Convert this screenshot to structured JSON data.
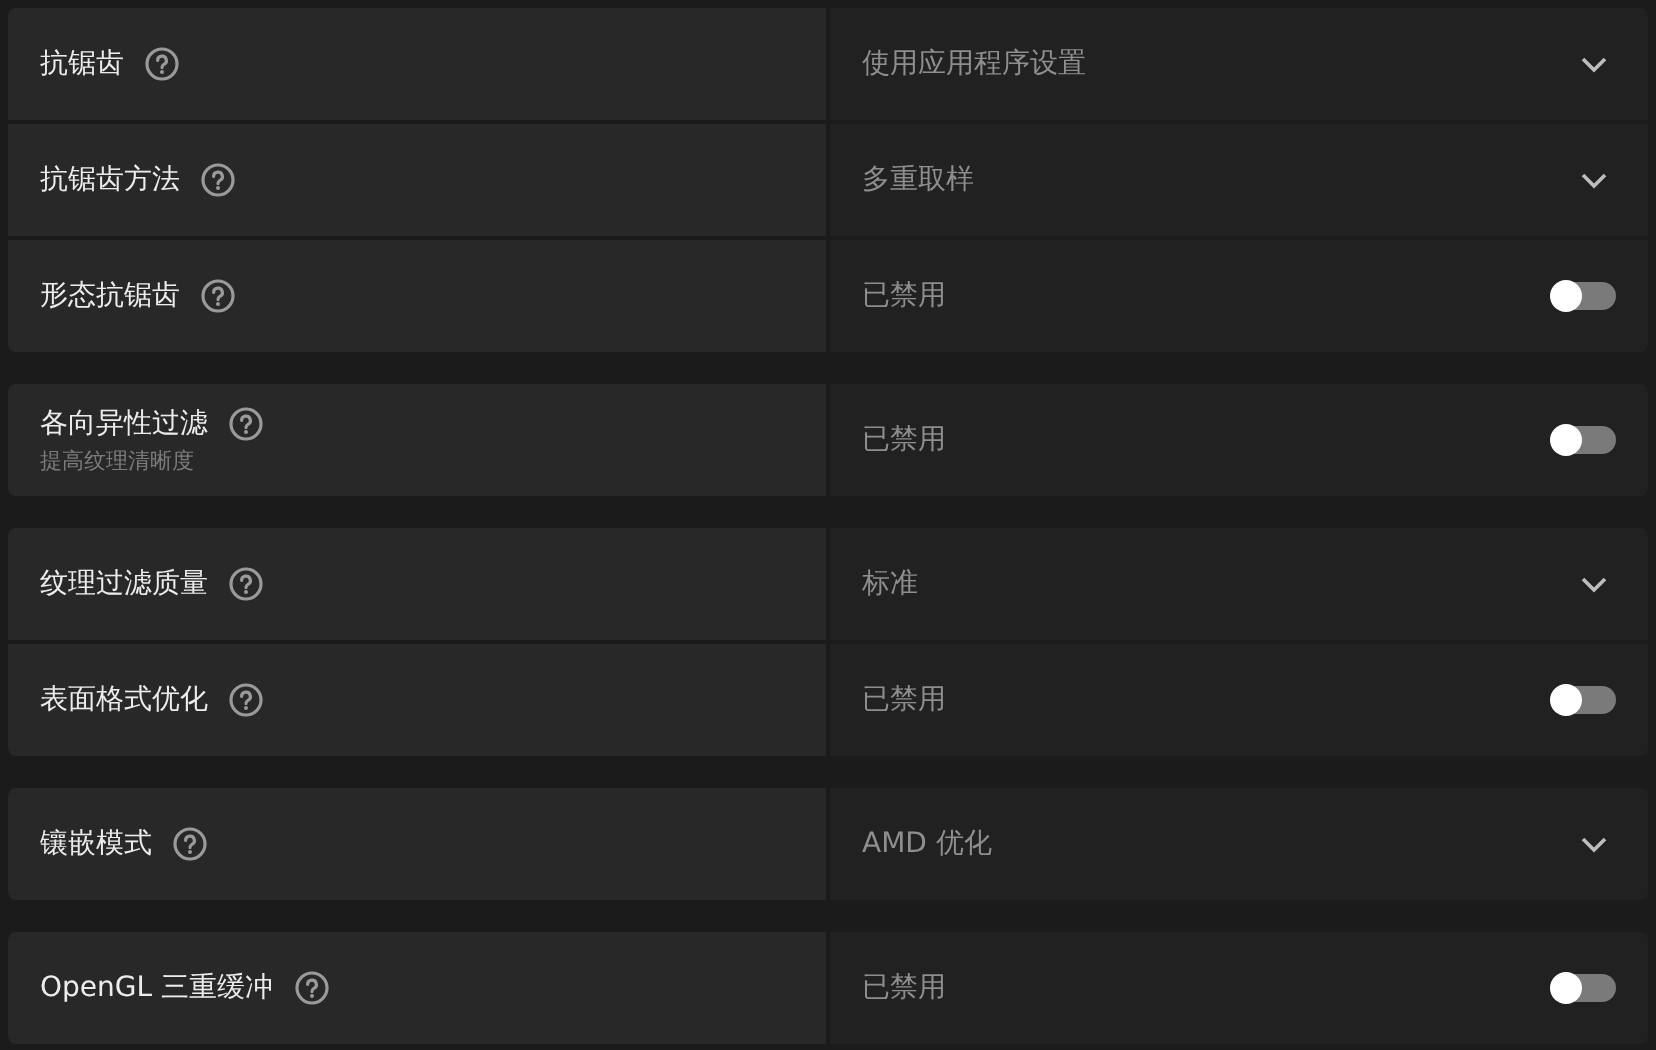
{
  "groups": [
    {
      "rows": [
        {
          "label": "抗锯齿",
          "kind": "dropdown",
          "value": "使用应用程序设置"
        },
        {
          "label": "抗锯齿方法",
          "kind": "dropdown",
          "value": "多重取样"
        },
        {
          "label": "形态抗锯齿",
          "kind": "toggle",
          "value": "已禁用",
          "on": false
        }
      ]
    },
    {
      "rows": [
        {
          "label": "各向异性过滤",
          "description": "提高纹理清晰度",
          "kind": "toggle",
          "value": "已禁用",
          "on": false
        }
      ]
    },
    {
      "rows": [
        {
          "label": "纹理过滤质量",
          "kind": "dropdown",
          "value": "标准"
        },
        {
          "label": "表面格式优化",
          "kind": "toggle",
          "value": "已禁用",
          "on": false
        }
      ]
    },
    {
      "rows": [
        {
          "label": "镶嵌模式",
          "kind": "dropdown",
          "value": "AMD 优化"
        }
      ]
    },
    {
      "rows": [
        {
          "label": "OpenGL 三重缓冲",
          "kind": "toggle",
          "value": "已禁用",
          "on": false
        }
      ]
    }
  ]
}
